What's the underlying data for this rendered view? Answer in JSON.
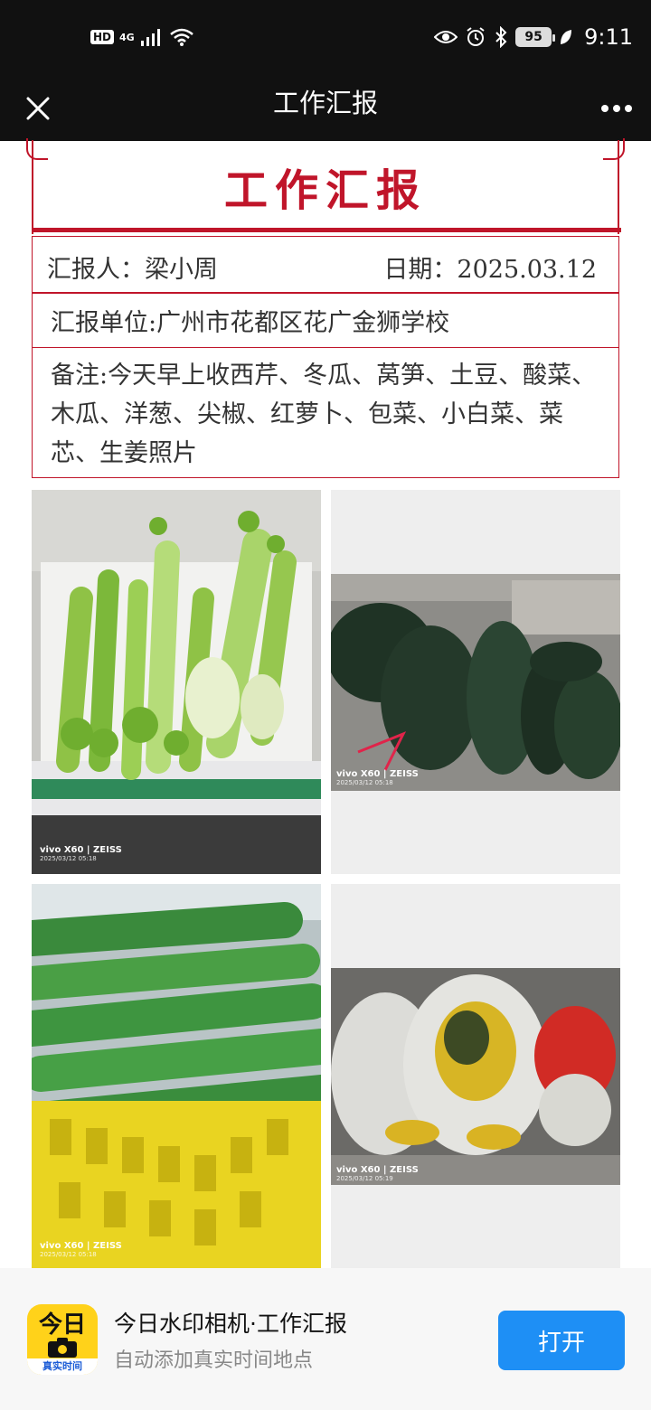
{
  "status_bar": {
    "hd": "HD",
    "network": "4G",
    "battery": "95",
    "time": "9:11"
  },
  "title_bar": {
    "title": "工作汇报",
    "close_icon": "close-icon",
    "more_icon": "more-icon"
  },
  "report": {
    "title": "工作汇报",
    "reporter": "汇报人：梁小周",
    "date": "日期：2025.03.12",
    "unit": "汇报单位:广州市花都区花广金狮学校",
    "notes": "备注:今天早上收西芹、冬瓜、莴笋、土豆、酸菜、木瓜、洋葱、尖椒、红萝卜、包菜、小白菜、菜芯、生姜照片",
    "accent_color": "#c0152a"
  },
  "photos": [
    {
      "subject": "celery",
      "camera": "vivo X60 | ZEISS",
      "timestamp": "2025/03/12 05:18"
    },
    {
      "subject": "winter-melon",
      "camera": "vivo X60 | ZEISS",
      "timestamp": "2025/03/12 05:18"
    },
    {
      "subject": "lettuce-stems",
      "camera": "vivo X60 | ZEISS",
      "timestamp": "2025/03/12 05:18"
    },
    {
      "subject": "pickled-vegetables",
      "camera": "vivo X60 | ZEISS",
      "timestamp": "2025/03/12 05:19"
    }
  ],
  "banner": {
    "app_icon_top": "今日",
    "app_icon_bottom": "真实时间",
    "title": "今日水印相机·工作汇报",
    "subtitle": "自动添加真实时间地点",
    "open_button": "打开",
    "button_color": "#1e8ff5"
  }
}
